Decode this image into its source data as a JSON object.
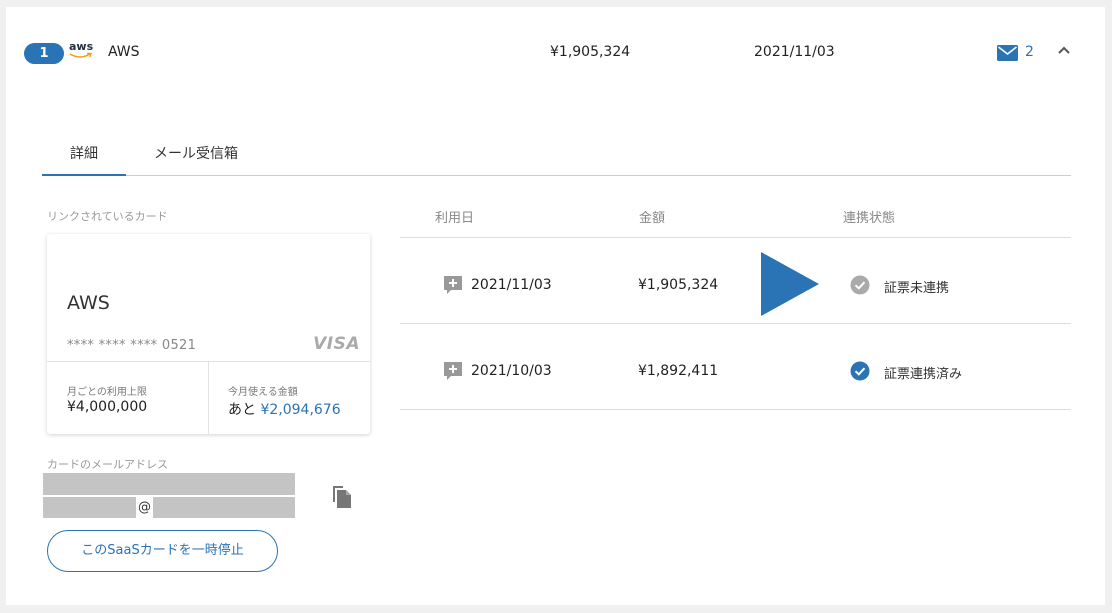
{
  "service": {
    "index": "1",
    "logo_text": "aws",
    "name": "AWS",
    "amount": "¥1,905,324",
    "date": "2021/11/03",
    "mail_count": "2",
    "mail_icon": "envelope-icon",
    "collapse_icon": "chevron-up-icon",
    "accent_color": "#2a73b4"
  },
  "tabs": [
    {
      "label": "詳細",
      "active": true
    },
    {
      "label": "メール受信箱",
      "active": false
    }
  ],
  "card_section": {
    "label": "リンクされているカード",
    "card_name": "AWS",
    "card_number": "**** **** **** 0521",
    "brand": "VISA",
    "limit_label": "月ごとの利用上限",
    "limit_value": "¥4,000,000",
    "available_label": "今月使える金額",
    "available_prefix": "あと",
    "available_value": "¥2,094,676"
  },
  "email_section": {
    "label": "カードのメールアドレス",
    "at_sign": "@",
    "copy_icon": "copy-icon"
  },
  "pause_button": {
    "label": "このSaaSカードを一時停止"
  },
  "table": {
    "headers": {
      "date": "利用日",
      "amount": "金額",
      "status": "連携状態"
    },
    "rows": [
      {
        "date": "2021/11/03",
        "amount": "¥1,905,324",
        "status": "証票未連携",
        "status_icon": "check-circle-gray-icon",
        "status_color": "#aaaaaa"
      },
      {
        "date": "2021/10/03",
        "amount": "¥1,892,411",
        "status": "証票連携済み",
        "status_icon": "check-circle-blue-icon",
        "status_color": "#2a73b4"
      }
    ],
    "row_icon": "add-comment-icon"
  }
}
